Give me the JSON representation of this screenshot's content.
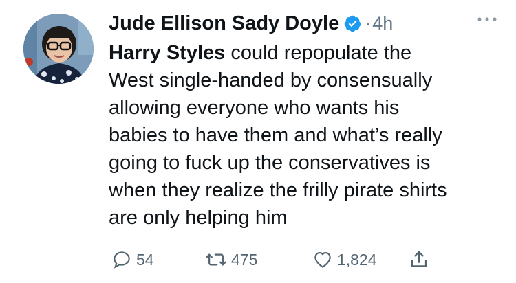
{
  "author": {
    "display_name": "Jude Ellison Sady Doyle",
    "verified": true,
    "separator": "·",
    "time_ago": "4h",
    "avatar_icon": "profile-photo"
  },
  "tweet": {
    "mention": "Harry Styles",
    "body": " could repopulate the\nWest single-handed by consensually\nallowing everyone who wants his\nbabies to have them and what’s really\ngoing to fuck up the conservatives is\nwhen they realize the frilly pirate shirts\nare only helping him"
  },
  "actions": {
    "reply": {
      "icon": "reply-icon",
      "count": "54"
    },
    "retweet": {
      "icon": "retweet-icon",
      "count": "475"
    },
    "like": {
      "icon": "heart-icon",
      "count": "1,824"
    },
    "share": {
      "icon": "share-icon"
    }
  },
  "colors": {
    "text": "#0f1419",
    "secondary": "#536471",
    "verified_blue": "#1d9bf0"
  }
}
